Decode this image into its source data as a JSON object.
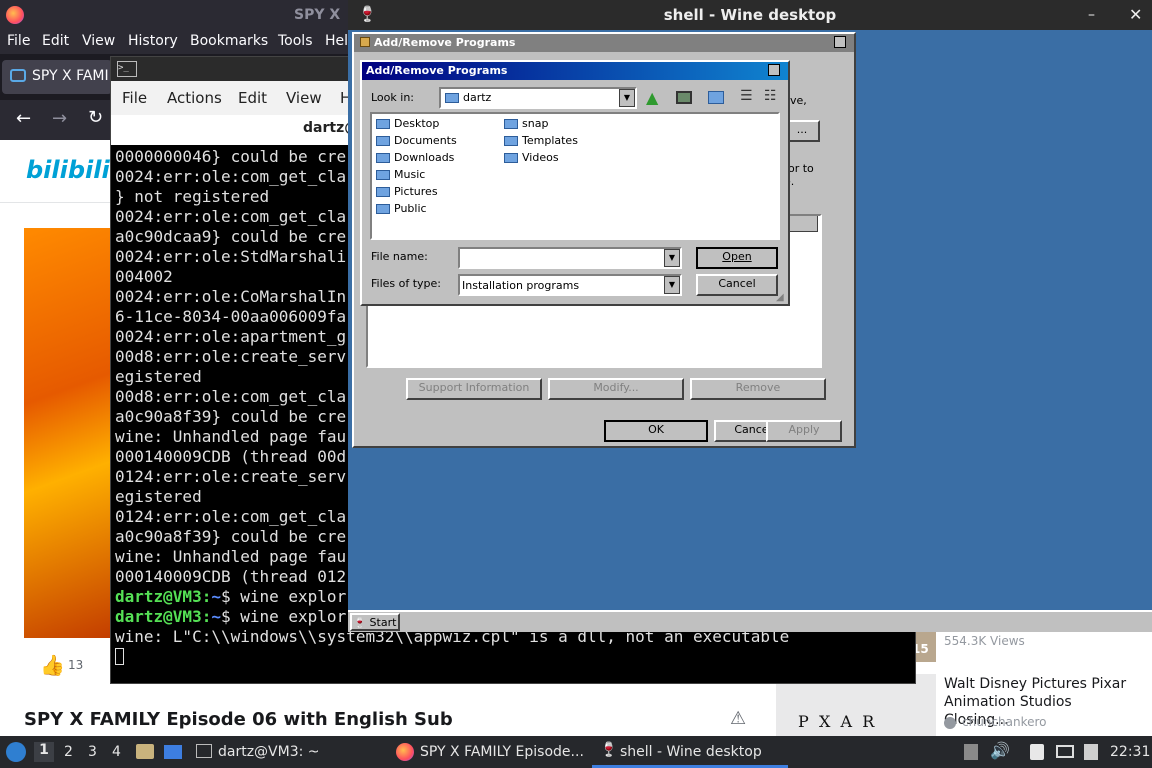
{
  "firefox": {
    "title": "SPY X",
    "menu": [
      "File",
      "Edit",
      "View",
      "History",
      "Bookmarks",
      "Tools",
      "Hel"
    ],
    "tab_label": "SPY X FAMIL",
    "site_logo": "bilibili",
    "like_count": "13",
    "video_title": "SPY X FAMILY Episode 06 with English Sub",
    "side_views": "554.3K Views",
    "side_badge": "15",
    "side_video_title": "Walt Disney Pictures Pixar Animation Studios Closing...",
    "side_channel": "chunchankero",
    "thumb_text": "P  X  A  R"
  },
  "terminal": {
    "menu": [
      "File",
      "Actions",
      "Edit",
      "View",
      "H"
    ],
    "header": "dartz@",
    "lines": [
      "0000000046} could be cre",
      "0024:err:ole:com_get_cla",
      "} not registered",
      "0024:err:ole:com_get_cla",
      "a0c90dcaa9} could be cre",
      "0024:err:ole:StdMarshali",
      "004002",
      "0024:err:ole:CoMarshalIn",
      "6-11ce-8034-00aa006009fa",
      "0024:err:ole:apartment_g",
      "00d8:err:ole:create_serv",
      "egistered",
      "00d8:err:ole:com_get_cla",
      "a0c90a8f39} could be cre",
      "wine: Unhandled page fau",
      "000140009CDB (thread 00d",
      "0124:err:ole:create_serv",
      "egistered",
      "0124:err:ole:com_get_cla",
      "a0c90a8f39} could be cre",
      "wine: Unhandled page fau",
      "000140009CDB (thread 012"
    ],
    "prompt_user": "dartz@VM3:",
    "prompt_path": "~",
    "prompt_cmd": "$ wine explor",
    "last_line": "wine: L\"C:\\\\windows\\\\system32\\\\appwiz.cpl\" is a dll, not an executable"
  },
  "wine": {
    "title": "shell - Wine desktop",
    "outer_dialog_title": "Add/Remove Programs",
    "outer_fragment1": "ve,",
    "outer_fragment2": "or to",
    "outer_fragment3": "e.",
    "outer_btn_fragment": "...",
    "support_btn": "Support Information",
    "modify_btn": "Modify...",
    "remove_btn": "Remove",
    "ok_btn": "OK",
    "cancel_btn": "Cancel",
    "apply_btn": "Apply",
    "start_label": "Start",
    "file_dialog": {
      "title": "Add/Remove Programs",
      "look_in_label": "Look in:",
      "look_in_value": "dartz",
      "folders_col1": [
        "Desktop",
        "Documents",
        "Downloads",
        "Music",
        "Pictures",
        "Public"
      ],
      "folders_col2": [
        "snap",
        "Templates",
        "Videos"
      ],
      "file_name_label": "File name:",
      "file_name_value": "",
      "files_of_type_label": "Files of type:",
      "files_of_type_value": "Installation programs",
      "open_btn": "Open",
      "cancel_btn": "Cancel"
    }
  },
  "taskbar": {
    "workspaces": [
      "1",
      "2",
      "3",
      "4"
    ],
    "tasks": [
      "dartz@VM3: ~",
      "SPY X FAMILY Episode...",
      "shell - Wine desktop"
    ],
    "clock": "22:31"
  }
}
